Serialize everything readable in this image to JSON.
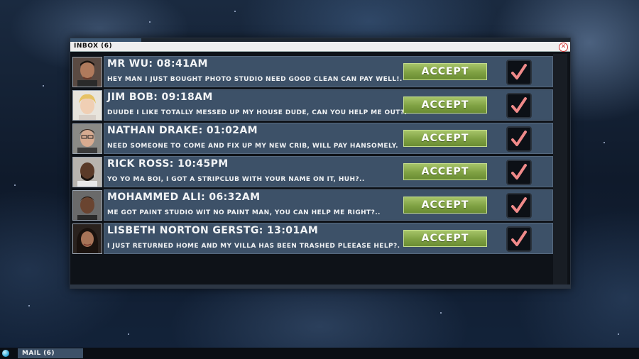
{
  "window": {
    "title": "INBOX (6)"
  },
  "messages": [
    {
      "sender": "MR WU",
      "time": "08:41AM",
      "header": "MR WU: 08:41AM",
      "text": "HEY MAN I JUST BOUGHT PHOTO STUDIO NEED GOOD CLEAN CAN PAY WELL!.",
      "accept_label": "ACCEPT",
      "avatar_icon": "portrait-mr-wu"
    },
    {
      "sender": "JIM BOB",
      "time": "09:18AM",
      "header": "JIM BOB: 09:18AM",
      "text": "DUUDE I LIKE TOTALLY MESSED UP MY HOUSE DUDE, CAN YOU HELP ME OUT?.",
      "accept_label": "ACCEPT",
      "avatar_icon": "portrait-jim-bob"
    },
    {
      "sender": "NATHAN DRAKE",
      "time": "01:02AM",
      "header": "NATHAN DRAKE: 01:02AM",
      "text": "NEED SOMEONE TO COME AND FIX UP MY NEW CRIB, WILL PAY HANSOMELY.",
      "accept_label": "ACCEPT",
      "avatar_icon": "portrait-nathan-drake"
    },
    {
      "sender": "RICK ROSS",
      "time": "10:45PM",
      "header": "RICK ROSS: 10:45PM",
      "text": "YO YO MA BOI, I GOT A STRIPCLUB WITH YOUR NAME ON IT, HUH?..",
      "accept_label": "ACCEPT",
      "avatar_icon": "portrait-rick-ross"
    },
    {
      "sender": "MOHAMMED ALI",
      "time": "06:32AM",
      "header": "MOHAMMED ALI: 06:32AM",
      "text": "ME GOT PAINT STUDIO WIT NO PAINT MAN, YOU CAN HELP ME RIGHT?..",
      "accept_label": "ACCEPT",
      "avatar_icon": "portrait-mohammed-ali"
    },
    {
      "sender": "LISBETH NORTON GERSTG",
      "time": "13:01AM",
      "header": "LISBETH NORTON GERSTG: 13:01AM",
      "text": "I JUST RETURNED HOME AND MY VILLA HAS BEEN TRASHED PLEEASE HELP?.",
      "accept_label": "ACCEPT",
      "avatar_icon": "portrait-lisbeth"
    }
  ],
  "taskbar": {
    "mail_label": "MAIL (6)"
  },
  "colors": {
    "accept": "#7fa143",
    "row_bg": "#3d5168",
    "check": "#f08a8a"
  }
}
